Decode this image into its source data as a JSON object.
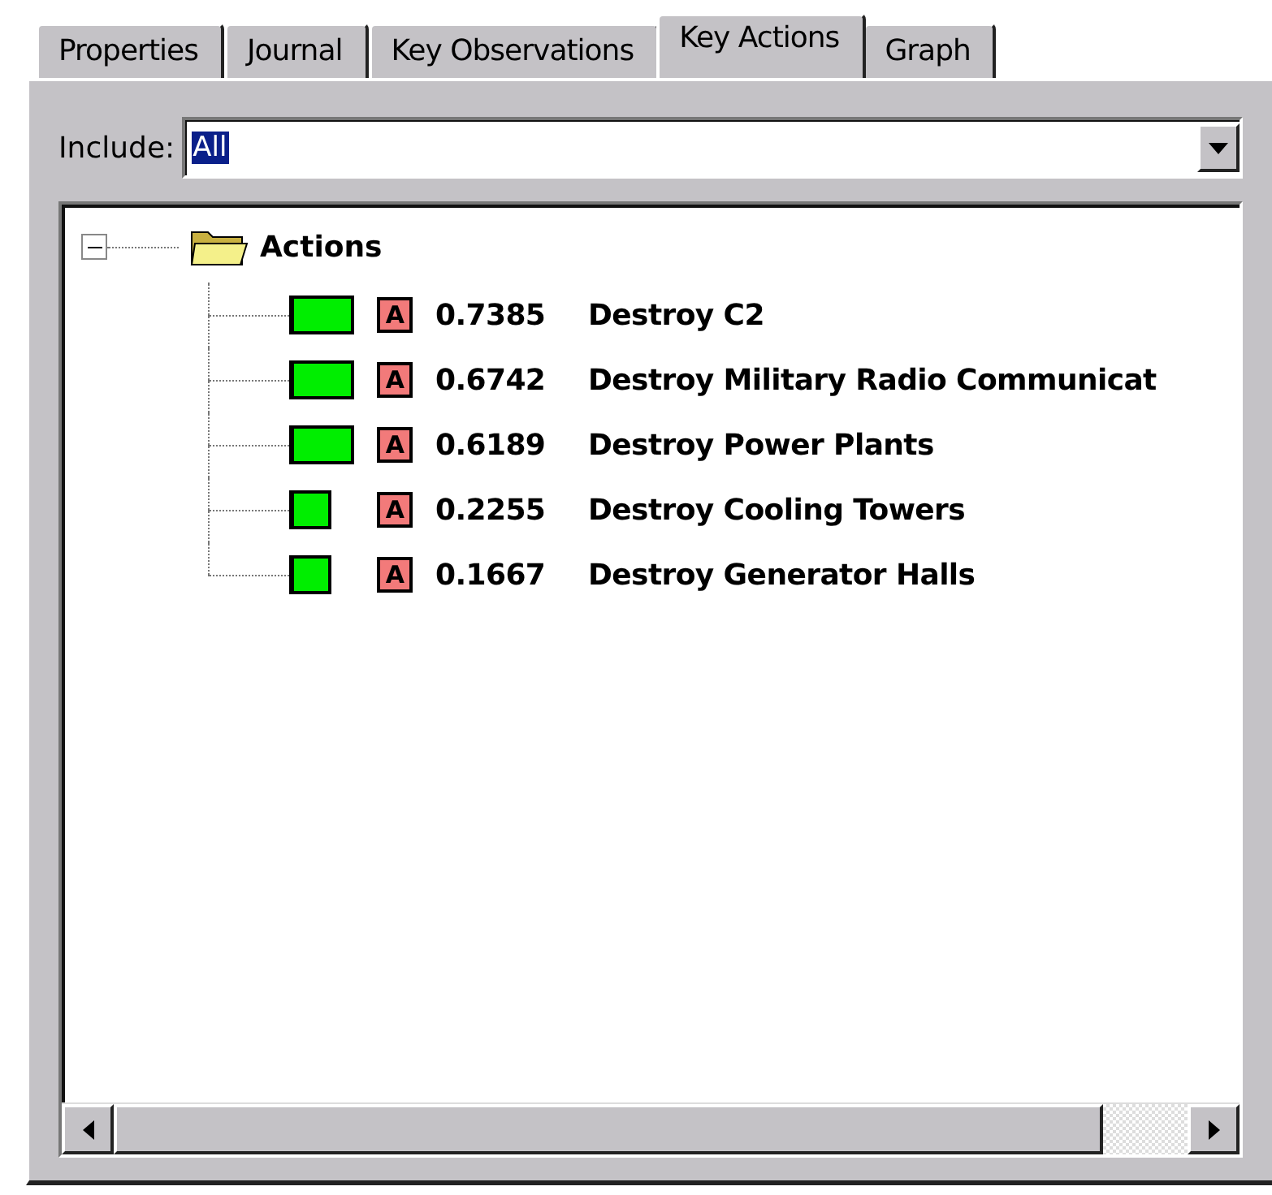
{
  "tabs": [
    {
      "label": "Properties",
      "selected": false
    },
    {
      "label": "Journal",
      "selected": false
    },
    {
      "label": "Key Observations",
      "selected": false
    },
    {
      "label": "Key Actions",
      "selected": true
    },
    {
      "label": "Graph",
      "selected": false
    }
  ],
  "include": {
    "label": "Include:",
    "value": "All"
  },
  "tree": {
    "label": "Actions",
    "expanded": true,
    "children": [
      {
        "kind": "long",
        "badge": "A",
        "score": "0.7385",
        "label": "Destroy C2"
      },
      {
        "kind": "long",
        "badge": "A",
        "score": "0.6742",
        "label": "Destroy Military Radio Communicat"
      },
      {
        "kind": "long",
        "badge": "A",
        "score": "0.6189",
        "label": "Destroy Power Plants"
      },
      {
        "kind": "short",
        "badge": "A",
        "score": "0.2255",
        "label": "Destroy Cooling Towers"
      },
      {
        "kind": "short",
        "badge": "A",
        "score": "0.1667",
        "label": "Destroy Generator Halls"
      }
    ]
  }
}
